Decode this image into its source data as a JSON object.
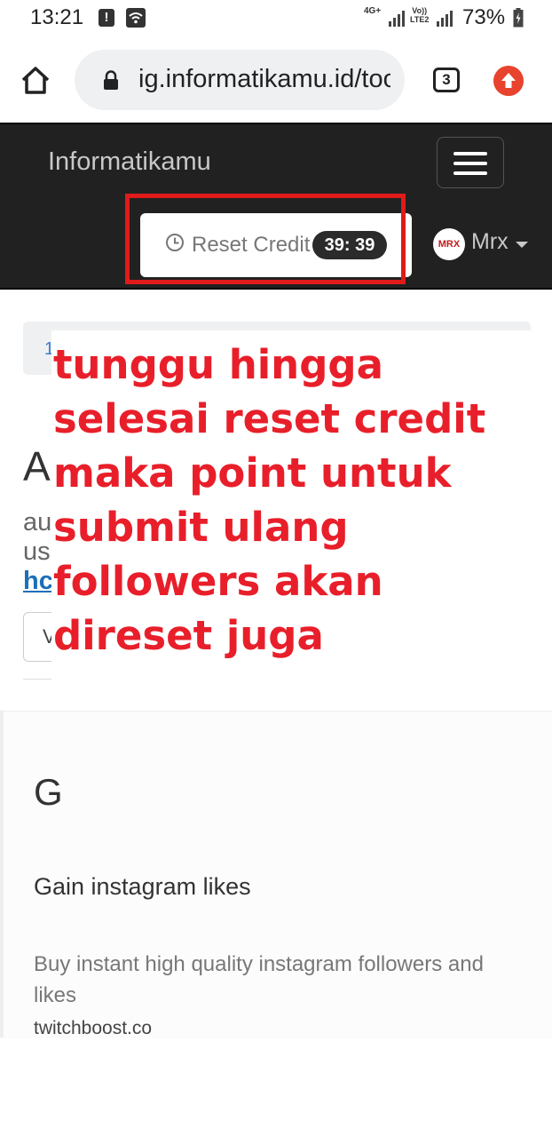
{
  "status_bar": {
    "time": "13:21",
    "notification_glyph": "!",
    "network_4g": "4G+",
    "network_volte": "Vo))\nLTE2",
    "battery": "73%"
  },
  "browser": {
    "url": "ig.informatikamu.id/too",
    "tab_count": "3"
  },
  "navbar": {
    "brand": "Informatikamu",
    "reset_label": "Reset Credit",
    "timer": "39: 39",
    "user": "Mrx",
    "avatar_text": "MRX"
  },
  "page": {
    "breadcrumb_fragment": "1",
    "heading_fragment": "A",
    "desc_fragment_1": "au",
    "desc_fragment_2": "us",
    "link_fragment": "hc",
    "select_fragment": "V"
  },
  "annotation": {
    "text": "tunggu hingga\nselesai reset credit\nmaka point untuk\nsubmit ulang\nfollowers akan\ndireset juga",
    "color": "#e81f2a"
  },
  "ad": {
    "icon_fragment": "G",
    "title": "Gain instagram likes",
    "description": "Buy instant high quality instagram followers and likes",
    "domain": "twitchboost.co"
  },
  "colors": {
    "navbar_bg": "#212121",
    "highlight": "#e11a1a",
    "link": "#1d6fb8"
  }
}
